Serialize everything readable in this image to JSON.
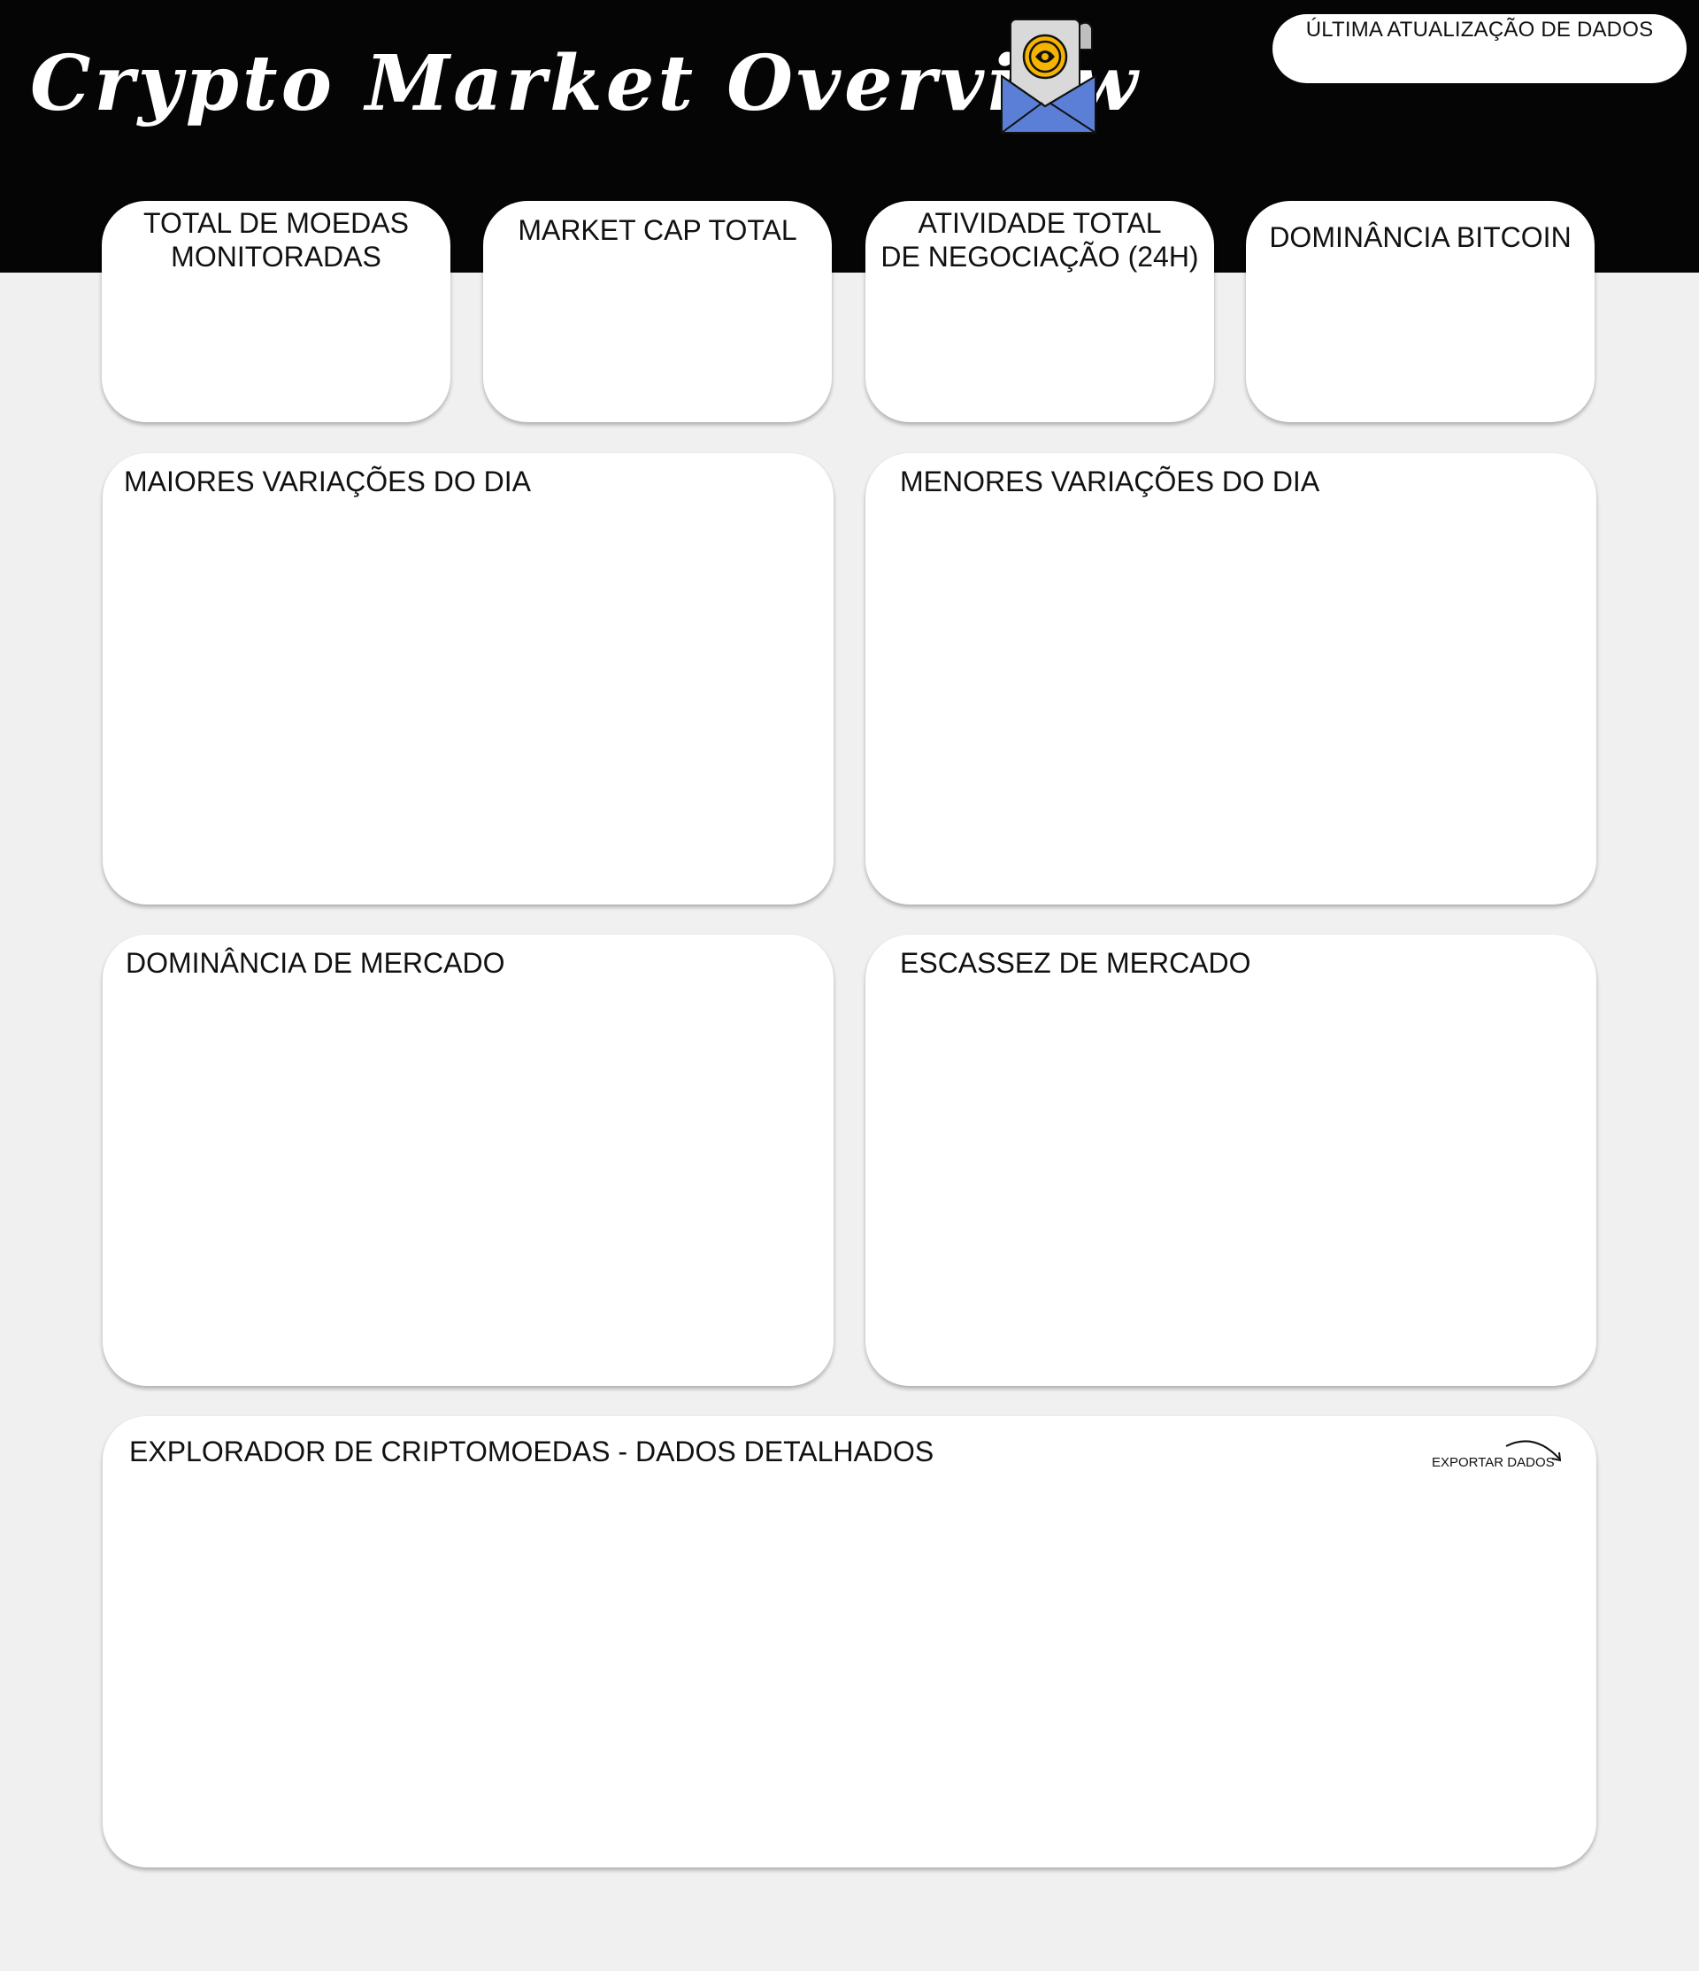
{
  "header": {
    "title": "Crypto Market Overview",
    "last_update_label": "ÚLTIMA ATUALIZAÇÃO DE DADOS"
  },
  "kpis": [
    {
      "label": "TOTAL DE MOEDAS\nMONITORADAS"
    },
    {
      "label": "MARKET CAP TOTAL"
    },
    {
      "label": "ATIVIDADE TOTAL\nDE NEGOCIAÇÃO (24H)"
    },
    {
      "label": "DOMINÂNCIA  BITCOIN"
    }
  ],
  "panels": {
    "top_gainers": "MAIORES VARIAÇÕES DO DIA",
    "top_losers": "MENORES VARIAÇÕES DO DIA",
    "market_dominance": "DOMINÂNCIA DE MERCADO",
    "market_scarcity": "ESCASSEZ DE MERCADO",
    "explorer": "EXPLORADOR DE CRIPTOMOEDAS - DADOS DETALHADOS"
  },
  "actions": {
    "export_label": "EXPORTAR DADOS"
  },
  "icons": {
    "logo": "crypto-coin-envelope-icon",
    "export": "curved-arrow-icon"
  },
  "colors": {
    "header_bg": "#050505",
    "page_bg": "#f0f0f0",
    "card_bg": "#ffffff",
    "envelope_blue": "#5b7fd6",
    "coin_gold": "#f5b400"
  }
}
